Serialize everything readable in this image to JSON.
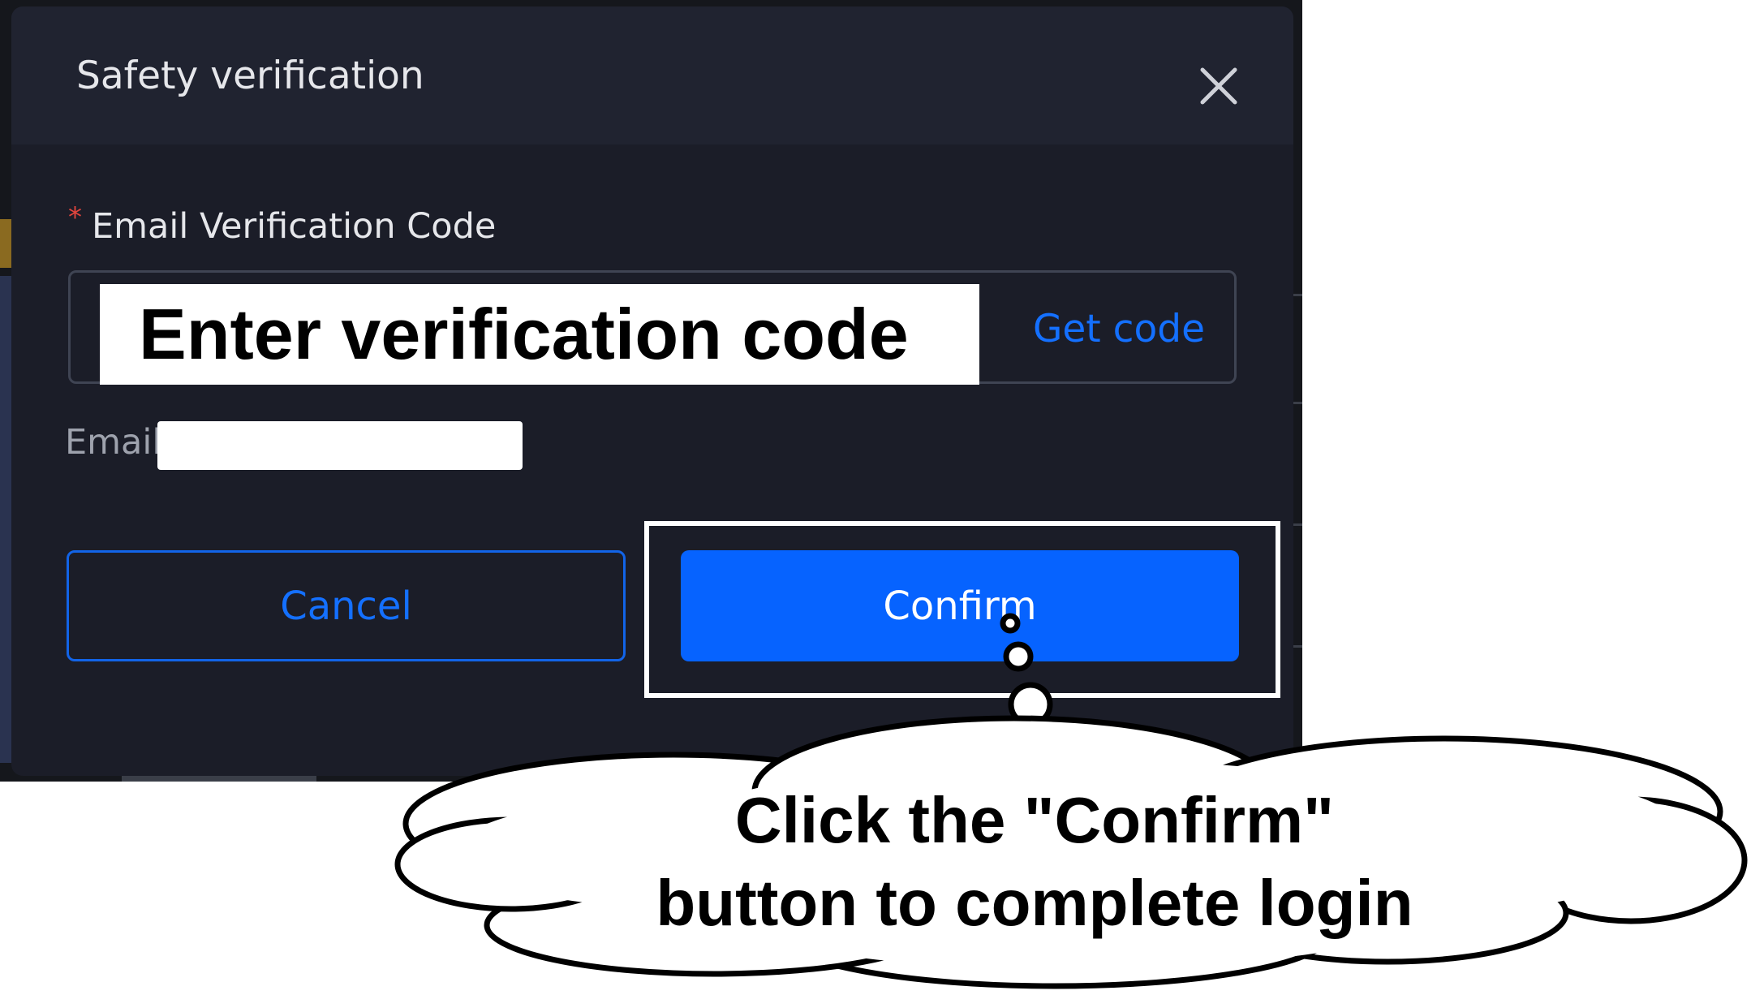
{
  "dialog": {
    "title": "Safety verification",
    "close_icon": "close-icon",
    "field": {
      "required_mark": "*",
      "label": "Email Verification Code",
      "placeholder": "Enter verification code",
      "get_code": "Get code"
    },
    "email_label": "Email",
    "cancel_label": "Cancel",
    "confirm_label": "Confirm"
  },
  "callout": {
    "line1": "Click the \"Confirm\"",
    "line2": "button to complete login"
  },
  "colors": {
    "dialog_bg": "#1b1d28",
    "header_bg": "#202330",
    "accent_blue": "#0663ff",
    "link_blue": "#1470ff",
    "required_red": "#e0453d"
  }
}
